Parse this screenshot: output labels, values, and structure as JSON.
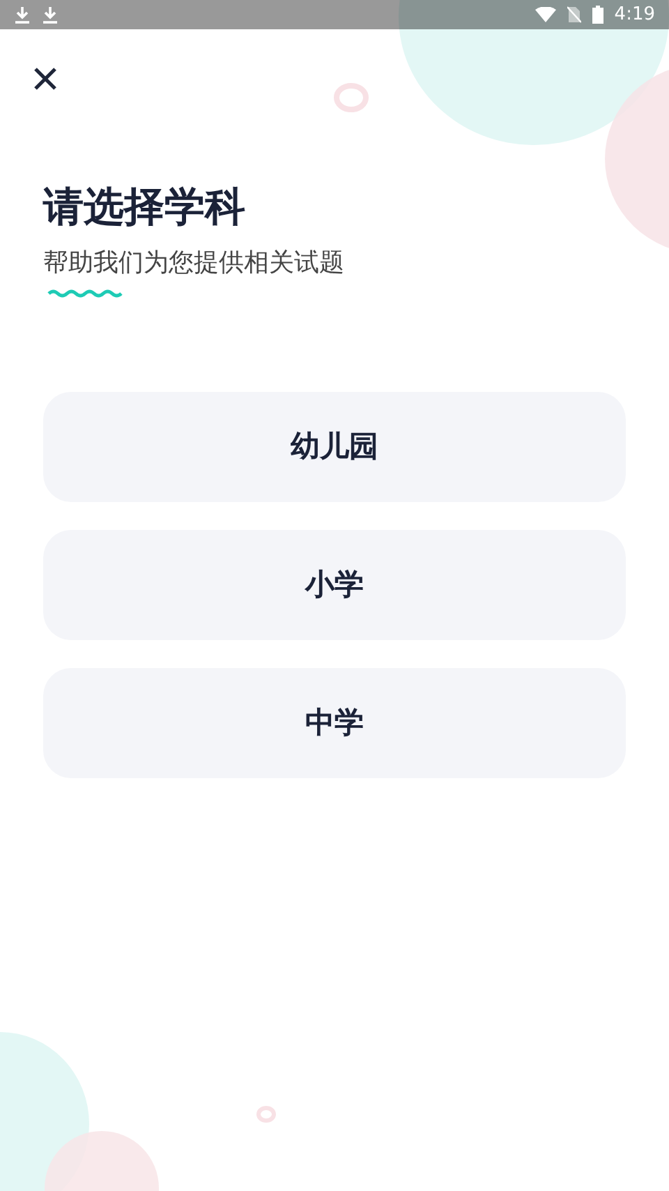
{
  "status_bar": {
    "time": "4:19"
  },
  "title": "请选择学科",
  "subtitle": "帮助我们为您提供相关试题",
  "options": [
    {
      "label": "幼儿园"
    },
    {
      "label": "小学"
    },
    {
      "label": "中学"
    }
  ]
}
